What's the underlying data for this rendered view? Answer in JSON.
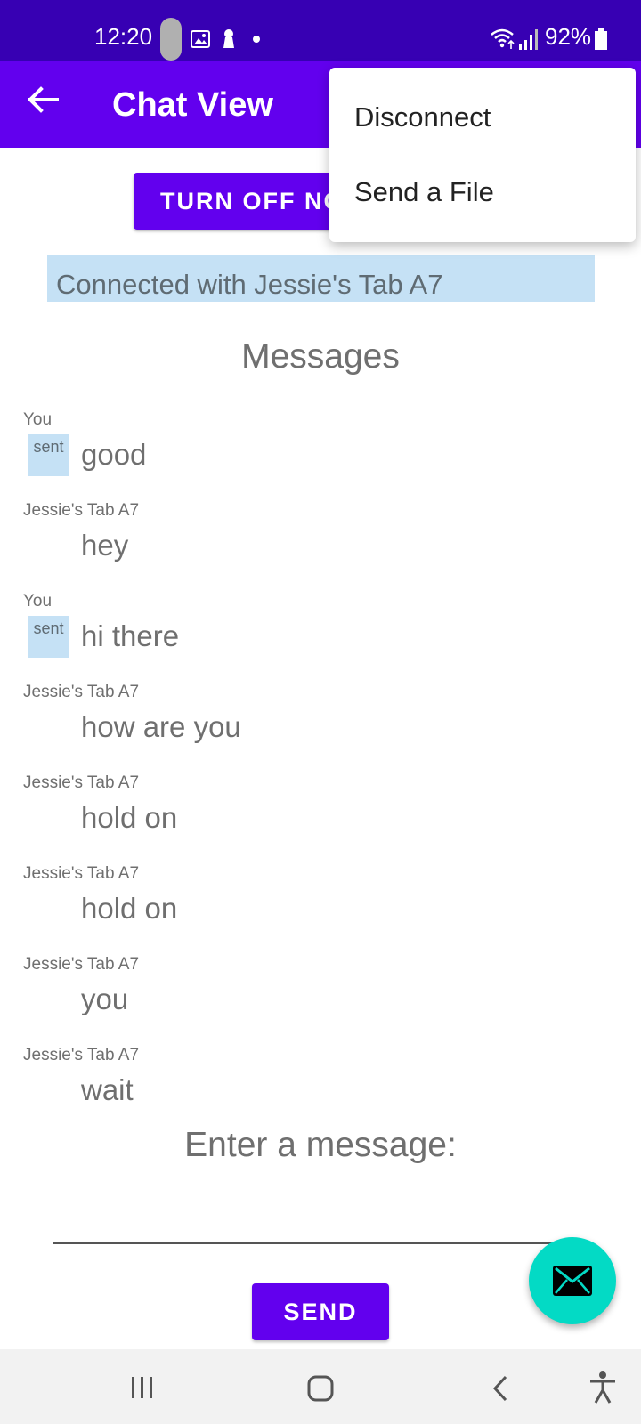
{
  "status_bar": {
    "time": "12:20",
    "battery": "92%"
  },
  "app_bar": {
    "title": "Chat View",
    "back_icon": "arrow-left-icon"
  },
  "top_button": {
    "label": "TURN OFF NO"
  },
  "connection": {
    "text": "Connected with Jessie's Tab A7"
  },
  "messages_title": "Messages",
  "messages": [
    {
      "sender": "You",
      "text": "good",
      "status": "sent"
    },
    {
      "sender": "Jessie's Tab A7",
      "text": "hey",
      "status": ""
    },
    {
      "sender": "You",
      "text": "hi there",
      "status": "sent"
    },
    {
      "sender": "Jessie's Tab A7",
      "text": "how are you",
      "status": ""
    },
    {
      "sender": "Jessie's Tab A7",
      "text": "hold on",
      "status": ""
    },
    {
      "sender": "Jessie's Tab A7",
      "text": "hold on",
      "status": ""
    },
    {
      "sender": "Jessie's Tab A7",
      "text": "you",
      "status": ""
    },
    {
      "sender": "Jessie's Tab A7",
      "text": "wait",
      "status": ""
    }
  ],
  "compose": {
    "label": "Enter a message:",
    "value": "",
    "send_label": "SEND"
  },
  "menu": {
    "items": [
      "Disconnect",
      "Send a File"
    ]
  },
  "fab": {
    "icon": "envelope-icon"
  },
  "nav_bar": {
    "icons": [
      "recents-icon",
      "home-icon",
      "back-icon",
      "accessibility-icon"
    ]
  },
  "colors": {
    "status_bar": "#3700b3",
    "primary": "#6200ee",
    "accent": "#03dac5",
    "highlight": "#c5e1f5"
  }
}
